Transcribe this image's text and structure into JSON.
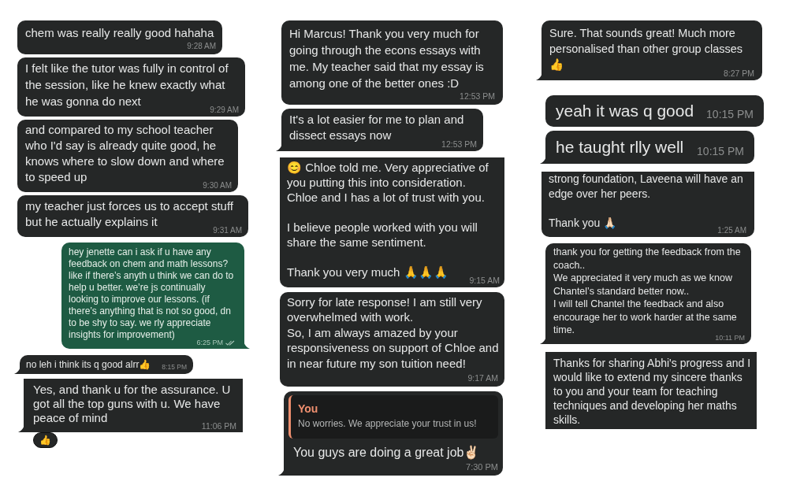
{
  "columns": [
    {
      "messages": [
        {
          "kind": "incoming",
          "tail": false,
          "text": "chem was really really good hahaha",
          "time": "9:28 AM"
        },
        {
          "kind": "incoming",
          "tail": false,
          "text": "I felt like the tutor was fully in control of the session, like he knew exactly what he was gonna do next",
          "time": "9:29 AM"
        },
        {
          "kind": "incoming",
          "tail": false,
          "text": "and compared to my school teacher who I'd say is already quite good, he knows where to slow down and where to speed up",
          "time": "9:30 AM"
        },
        {
          "kind": "incoming",
          "tail": false,
          "text": "my teacher just forces us to accept stuff but he actually explains it",
          "time": "9:31 AM"
        },
        {
          "kind": "outgoing",
          "tail": true,
          "text": "hey jenette can i ask if u have any feedback on chem and math lessons? like if there’s anyth u think we can do to help u better. we’re js continually looking to improve our lessons. (if there’s anything that is not so good, dn to be shy to say. we rly appreciate insights for improvement)",
          "time": "6:25 PM",
          "delivered": true
        },
        {
          "kind": "incoming",
          "tail": true,
          "text": "no leh i think its q good alrr👍",
          "time": "8:15 PM"
        },
        {
          "kind": "square",
          "tail": true,
          "text": "Yes, and thank u for the assurance. U got all the top guns with u. We have peace of mind",
          "time": "11:06 PM",
          "reactions": [
            "👍"
          ]
        }
      ]
    },
    {
      "messages": [
        {
          "kind": "incoming",
          "tail": false,
          "text": "Hi Marcus! Thank you very much for going through the econs essays with me. My teacher said that my essay is among one of the better ones :D",
          "time": "12:53 PM"
        },
        {
          "kind": "incoming",
          "tail": true,
          "text": "It's a lot easier for me to plan and dissect essays now",
          "time": "12:53 PM"
        },
        {
          "kind": "cropped",
          "tail": false,
          "text": "😊 Chloe told me. Very appreciative of you putting this into consideration. Chloe and I has a lot of trust with you.\n\nI believe people worked with you will share the same sentiment.\n\nThank you very much 🙏🙏🙏",
          "time": "9:15 AM"
        },
        {
          "kind": "incoming",
          "tail": false,
          "text": "Sorry for late response! I am still very overwhelmed with work.\nSo, I am always amazed by your responsiveness on support of Chloe and in near future my son tuition need!",
          "time": "9:17 AM"
        },
        {
          "kind": "incoming",
          "tail": true,
          "reply_to": {
            "author": "You",
            "text": "No worries. We appreciate your trust in us!"
          },
          "text": "You guys are doing a great job✌🏻",
          "time": "7:30 PM"
        }
      ]
    },
    {
      "messages": [
        {
          "kind": "incoming",
          "tail": true,
          "text": "Sure. That sounds great! Much more personalised than other group classes 👍",
          "time": "8:27 PM"
        },
        {
          "kind": "incoming",
          "tail": false,
          "text": "yeah it was q good",
          "time": "10:15 PM"
        },
        {
          "kind": "incoming",
          "tail": true,
          "text": "he taught rlly well",
          "time": "10:15 PM"
        },
        {
          "kind": "cropped",
          "tail": false,
          "text": "strong foundation, Laveena will have an edge over her peers.\n\nThank you 🙏🏻",
          "time": "1:25 AM"
        },
        {
          "kind": "incoming",
          "tail": true,
          "text": "thank you for getting the feedback from the coach..\nWe appreciated it very much as we know Chantel’s standard better now..\nI will tell Chantel the feedback and also encourage her to work harder at the same time.",
          "time": "10:11 PM"
        },
        {
          "kind": "square",
          "tail": false,
          "text": "Thanks for sharing Abhi's progress and I would like to extend my sincere thanks to you and your team for teaching techniques and developing her maths skills."
        }
      ]
    }
  ]
}
